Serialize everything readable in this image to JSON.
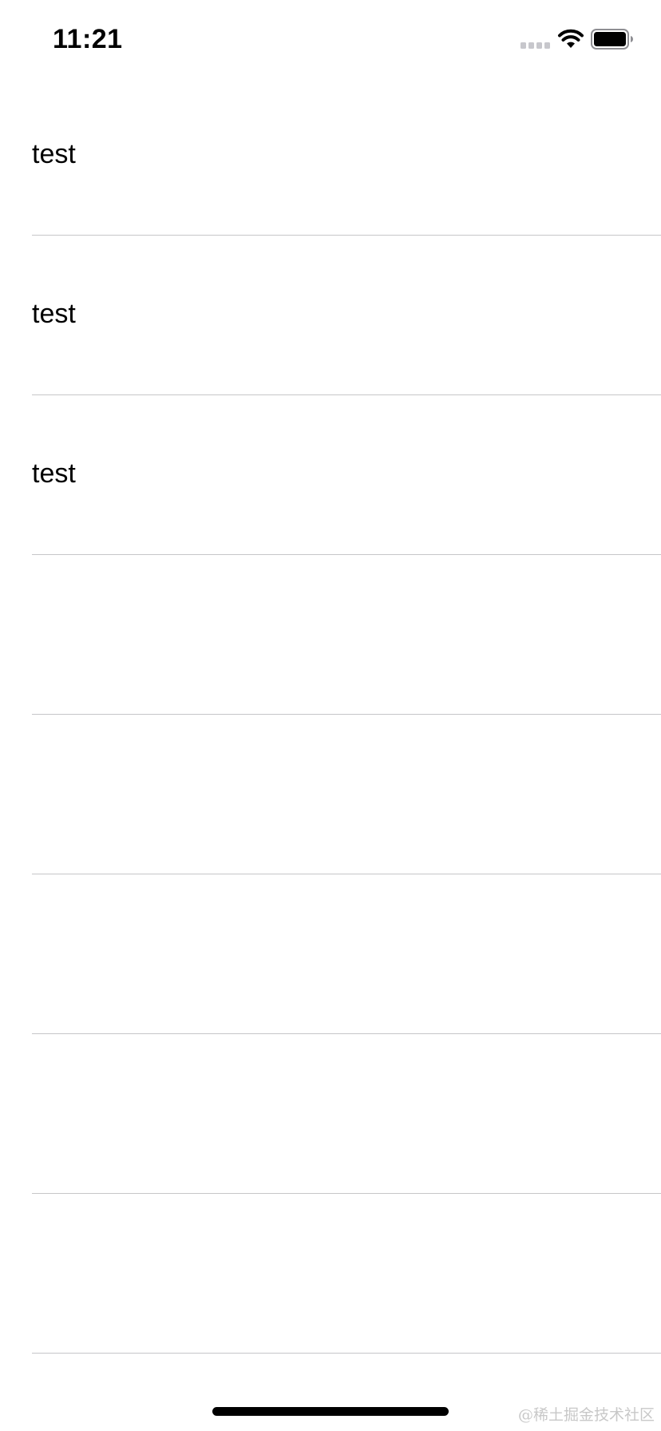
{
  "status_bar": {
    "time": "11:21",
    "icons": [
      "cellular-signal-icon",
      "wifi-icon",
      "battery-icon"
    ]
  },
  "table": {
    "rows": [
      {
        "label": "test"
      },
      {
        "label": "test"
      },
      {
        "label": "test"
      },
      {
        "label": ""
      },
      {
        "label": ""
      },
      {
        "label": ""
      },
      {
        "label": ""
      },
      {
        "label": ""
      }
    ]
  },
  "watermark": "@稀土掘金技术社区",
  "colors": {
    "background": "#ffffff",
    "text": "#000000",
    "separator": "#c6c6c8",
    "signal_inactive": "#c7c7cc",
    "watermark": "#c8c8c8"
  }
}
